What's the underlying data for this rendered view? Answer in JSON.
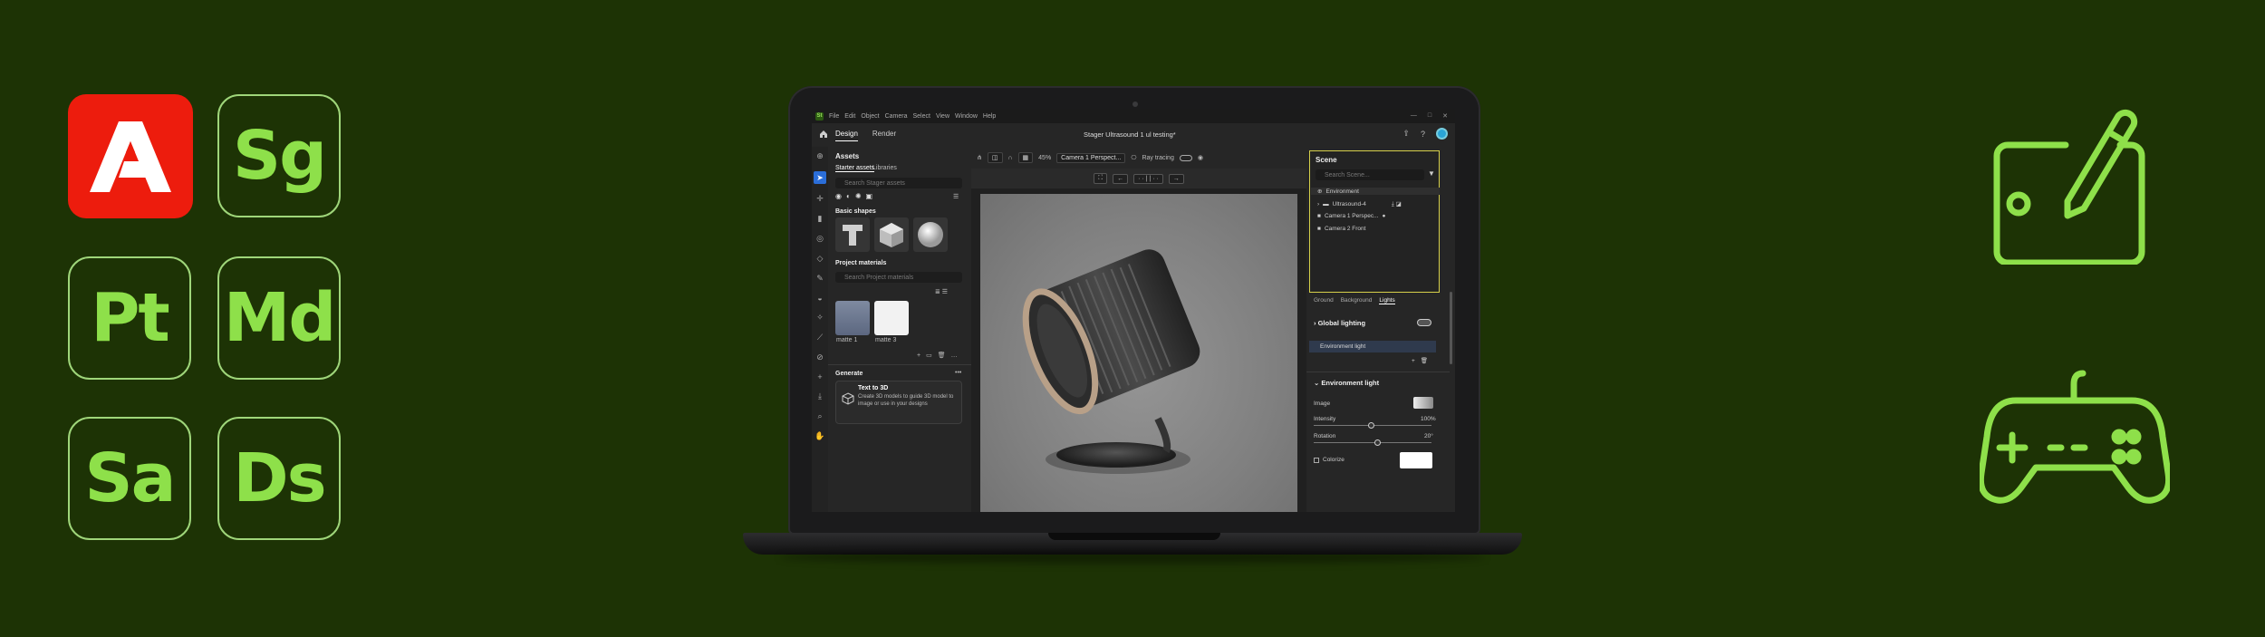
{
  "apps": {
    "adobe_logo": "adobe-logo",
    "icons": [
      {
        "id": "sg",
        "label": "Sg"
      },
      {
        "id": "pt",
        "label": "Pt"
      },
      {
        "id": "md",
        "label": "Md"
      },
      {
        "id": "sa",
        "label": "Sa"
      },
      {
        "id": "ds",
        "label": "Ds"
      }
    ]
  },
  "colors": {
    "background": "#1d3305",
    "app_icon_text": "#8ee04a",
    "adobe_red": "#ed1c0d",
    "scene_highlight": "#d6d04b"
  },
  "decor_icons": [
    "tablet-pen-icon",
    "gamepad-icon"
  ],
  "app": {
    "logo_text": "St",
    "menu": [
      "File",
      "Edit",
      "Object",
      "Camera",
      "Select",
      "View",
      "Window",
      "Help"
    ],
    "window_controls": [
      "—",
      "□",
      "✕"
    ],
    "tabs": [
      "Design",
      "Render"
    ],
    "active_tab": "Design",
    "document_title": "Stager Ultrasound 1 ul testing*"
  },
  "assets": {
    "title": "Assets",
    "subtabs": [
      "Starter assets",
      "Libraries"
    ],
    "search_placeholder": "Search Stager assets",
    "basic_shapes_title": "Basic shapes",
    "project_materials_title": "Project materials",
    "materials_search_placeholder": "Search Project materials",
    "materials": [
      "matte 1",
      "matte 3"
    ],
    "generate_title": "Generate",
    "text_to_3d_title": "Text to 3D",
    "text_to_3d_desc": "Create 3D models to guide 3D model to image or use in your designs"
  },
  "viewport_toolbar": {
    "zoom": "45%",
    "camera": "Camera 1 Perspect...",
    "ray_tracing_label": "Ray tracing"
  },
  "scene": {
    "title": "Scene",
    "search_placeholder": "Search Scene...",
    "items": [
      "Environment",
      "Ultrasound-4",
      "Camera 1 Perspec...",
      "Camera 2 Front"
    ],
    "subtabs": [
      "Ground",
      "Background",
      "Lights"
    ],
    "active_subtab": "Lights",
    "global_lighting": "Global lighting",
    "env_light_item": "Environment light",
    "env_light_section": "Environment light",
    "image_label": "Image",
    "intensity_label": "Intensity",
    "intensity_value": "100%",
    "rotation_label": "Rotation",
    "rotation_value": "20°",
    "colorize_label": "Colorize"
  }
}
